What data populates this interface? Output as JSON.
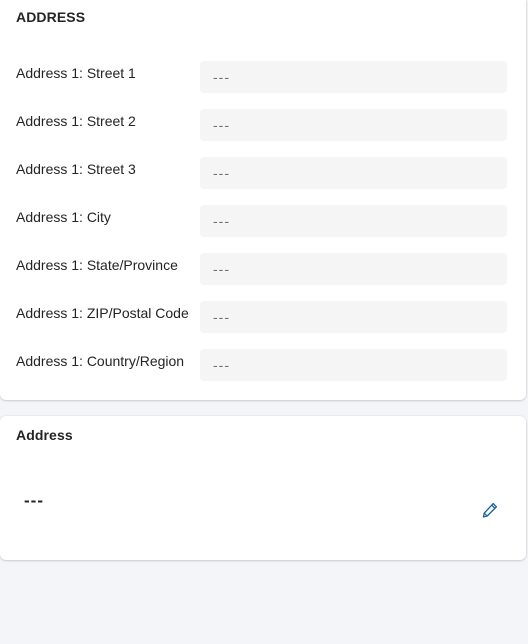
{
  "address_section": {
    "title": "ADDRESS",
    "fields": [
      {
        "label": "Address 1: Street 1",
        "value": "---"
      },
      {
        "label": "Address 1: Street 2",
        "value": "---"
      },
      {
        "label": "Address 1: Street 3",
        "value": "---"
      },
      {
        "label": "Address 1: City",
        "value": "---"
      },
      {
        "label": "Address 1: State/Province",
        "value": "---"
      },
      {
        "label": "Address 1: ZIP/Postal Code",
        "value": "---"
      },
      {
        "label": "Address 1: Country/Region",
        "value": "---"
      }
    ]
  },
  "address_card": {
    "title": "Address",
    "value": "---",
    "edit_icon": "pencil-icon"
  },
  "colors": {
    "accent": "#115ea3",
    "field_bg": "#f5f5f5",
    "page_bg": "#f4f5f8"
  }
}
